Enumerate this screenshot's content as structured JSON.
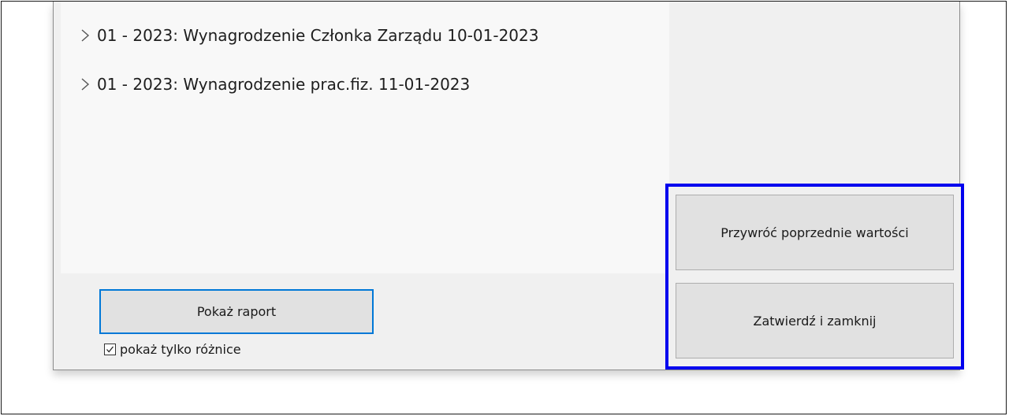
{
  "list": {
    "items": [
      {
        "label": "01 - 2023: Wynagrodzenie Członka Zarządu 10-01-2023",
        "icon": "chevron-right-icon"
      },
      {
        "label": "01 - 2023: Wynagrodzenie prac.fiz. 11-01-2023",
        "icon": "chevron-right-icon"
      }
    ]
  },
  "buttons": {
    "report_label": "Pokaż raport",
    "restore_label": "Przywróć poprzednie wartości",
    "confirm_label": "Zatwierdź i zamknij"
  },
  "options": {
    "show_only_differences_label": "pokaż tylko różnice",
    "show_only_differences_checked": true
  },
  "colors": {
    "highlight_border": "#0000ee",
    "focus_border": "#0078d7"
  }
}
